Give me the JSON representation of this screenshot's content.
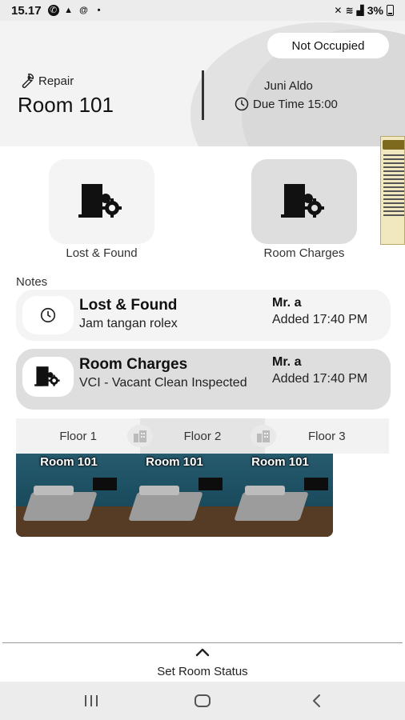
{
  "status_bar": {
    "time": "15.17",
    "battery": "3%",
    "icons": [
      "whatsapp-icon",
      "warning-icon",
      "at-icon",
      "dot-icon",
      "mute-icon",
      "wifi-icon",
      "signal-icon",
      "battery-icon"
    ]
  },
  "header": {
    "task_label": "Repair",
    "task_icon": "wrench-icon",
    "room_title": "Room 101",
    "occupant": "Juni Aldo",
    "due_time": "Due Time 15:00",
    "occupancy_badge": "Not Occupied"
  },
  "actions": [
    {
      "label": "Lost & Found",
      "icon": "door-gear-icon"
    },
    {
      "label": "Room Charges",
      "icon": "door-gear-icon"
    }
  ],
  "notes": {
    "label": "Notes",
    "items": [
      {
        "title": "Lost & Found",
        "description": "Jam tangan rolex",
        "by": "Mr. a",
        "added": "Added 17:40 PM",
        "icon": "clock-icon"
      },
      {
        "title": "Room Charges",
        "description": "VCI - Vacant Clean Inspected",
        "by": "Mr. a",
        "added": "Added 17:40 PM",
        "icon": "door-gear-icon"
      }
    ]
  },
  "floors": {
    "tabs": [
      "Floor 1",
      "Floor 2",
      "Floor 3"
    ],
    "active": "Floor 2"
  },
  "rooms": [
    "Room 101",
    "Room 101",
    "Room 101"
  ],
  "bottom_sheet": {
    "label": "Set Room Status"
  },
  "colors": {
    "header_bg": "#f3f3f3",
    "tile_active": "#dedede",
    "tile_light": "#f4f4f4",
    "wall": "#2f6f86",
    "floor": "#6b4a2e"
  }
}
